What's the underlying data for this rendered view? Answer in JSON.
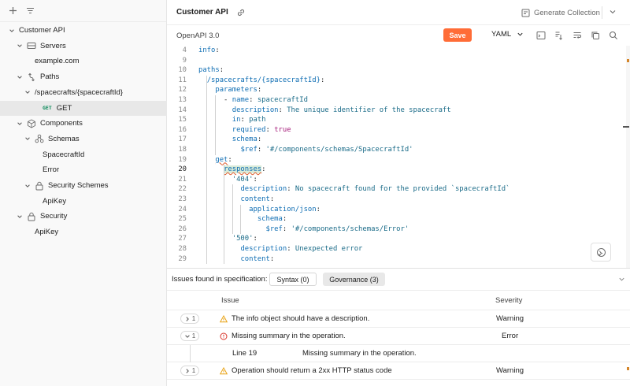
{
  "sidebar": {
    "tree": [
      {
        "label": "Customer API",
        "icon": "none",
        "chevron": "down",
        "level": 0
      },
      {
        "label": "Servers",
        "icon": "server-icon",
        "chevron": "down",
        "level": 1
      },
      {
        "label": "example.com",
        "icon": "none",
        "chevron": "none",
        "level": 2
      },
      {
        "label": "Paths",
        "icon": "paths-icon",
        "chevron": "down",
        "level": 1
      },
      {
        "label": "/spacecrafts/{spacecraftId}",
        "icon": "none",
        "chevron": "down",
        "level": 2
      },
      {
        "label": "GET",
        "method": "GET",
        "icon": "none",
        "chevron": "none",
        "level": 3,
        "selected": true
      },
      {
        "label": "Components",
        "icon": "cube-icon",
        "chevron": "down",
        "level": 1
      },
      {
        "label": "Schemas",
        "icon": "schema-icon",
        "chevron": "down",
        "level": 2
      },
      {
        "label": "SpacecraftId",
        "icon": "none",
        "chevron": "none",
        "level": 3
      },
      {
        "label": "Error",
        "icon": "none",
        "chevron": "none",
        "level": 3
      },
      {
        "label": "Security Schemes",
        "icon": "lock-icon",
        "chevron": "down",
        "level": 2
      },
      {
        "label": "ApiKey",
        "icon": "none",
        "chevron": "none",
        "level": 3
      },
      {
        "label": "Security",
        "icon": "lock-icon",
        "chevron": "down",
        "level": 1
      },
      {
        "label": "ApiKey",
        "icon": "none",
        "chevron": "none",
        "level": 2
      }
    ]
  },
  "header": {
    "title": "Customer API",
    "generate_label": "Generate Collection"
  },
  "toolbar": {
    "spec_version": "OpenAPI 3.0",
    "save_label": "Save",
    "format": "YAML"
  },
  "editor": {
    "lines": [
      {
        "n": "4",
        "tokens": [
          [
            "k",
            "info"
          ],
          [
            "p",
            ":"
          ]
        ]
      },
      {
        "n": "9",
        "tokens": []
      },
      {
        "n": "10",
        "tokens": [
          [
            "k",
            "paths"
          ],
          [
            "p",
            ":"
          ]
        ]
      },
      {
        "n": "11",
        "tokens": [
          [
            "p",
            "  "
          ],
          [
            "k",
            "/spacecrafts/{spacecraftId}"
          ],
          [
            "p",
            ":"
          ]
        ]
      },
      {
        "n": "12",
        "tokens": [
          [
            "p",
            "    "
          ],
          [
            "k",
            "parameters"
          ],
          [
            "p",
            ":"
          ]
        ]
      },
      {
        "n": "13",
        "tokens": [
          [
            "p",
            "      - "
          ],
          [
            "k",
            "name"
          ],
          [
            "p",
            ": "
          ],
          [
            "s",
            "spacecraftId"
          ]
        ]
      },
      {
        "n": "14",
        "tokens": [
          [
            "p",
            "        "
          ],
          [
            "k",
            "description"
          ],
          [
            "p",
            ": "
          ],
          [
            "s",
            "The unique identifier of the spacecraft"
          ]
        ]
      },
      {
        "n": "15",
        "tokens": [
          [
            "p",
            "        "
          ],
          [
            "k",
            "in"
          ],
          [
            "p",
            ": "
          ],
          [
            "s",
            "path"
          ]
        ]
      },
      {
        "n": "16",
        "tokens": [
          [
            "p",
            "        "
          ],
          [
            "k",
            "required"
          ],
          [
            "p",
            ": "
          ],
          [
            "t",
            "true"
          ]
        ]
      },
      {
        "n": "17",
        "tokens": [
          [
            "p",
            "        "
          ],
          [
            "k",
            "schema"
          ],
          [
            "p",
            ":"
          ]
        ]
      },
      {
        "n": "18",
        "tokens": [
          [
            "p",
            "          "
          ],
          [
            "k",
            "$ref"
          ],
          [
            "p",
            ": "
          ],
          [
            "s",
            "'#/components/schemas/SpacecraftId'"
          ]
        ]
      },
      {
        "n": "19",
        "tokens": [
          [
            "p",
            "    "
          ],
          [
            "k",
            "get"
          ],
          [
            "p",
            ":"
          ]
        ],
        "squiggle": 1
      },
      {
        "n": "20",
        "tokens": [
          [
            "p",
            "      "
          ],
          [
            "k",
            "responses"
          ],
          [
            "p",
            ":"
          ]
        ],
        "highlight": 1,
        "active": true
      },
      {
        "n": "21",
        "tokens": [
          [
            "p",
            "        "
          ],
          [
            "s",
            "'404'"
          ],
          [
            "p",
            ":"
          ]
        ]
      },
      {
        "n": "22",
        "tokens": [
          [
            "p",
            "          "
          ],
          [
            "k",
            "description"
          ],
          [
            "p",
            ": "
          ],
          [
            "s",
            "No spacecraft found for the provided `spacecraftId`"
          ]
        ]
      },
      {
        "n": "23",
        "tokens": [
          [
            "p",
            "          "
          ],
          [
            "k",
            "content"
          ],
          [
            "p",
            ":"
          ]
        ]
      },
      {
        "n": "24",
        "tokens": [
          [
            "p",
            "            "
          ],
          [
            "k",
            "application/json"
          ],
          [
            "p",
            ":"
          ]
        ]
      },
      {
        "n": "25",
        "tokens": [
          [
            "p",
            "              "
          ],
          [
            "k",
            "schema"
          ],
          [
            "p",
            ":"
          ]
        ]
      },
      {
        "n": "26",
        "tokens": [
          [
            "p",
            "                "
          ],
          [
            "k",
            "$ref"
          ],
          [
            "p",
            ": "
          ],
          [
            "s",
            "'#/components/schemas/Error'"
          ]
        ]
      },
      {
        "n": "27",
        "tokens": [
          [
            "p",
            "        "
          ],
          [
            "s",
            "'500'"
          ],
          [
            "p",
            ":"
          ]
        ]
      },
      {
        "n": "28",
        "tokens": [
          [
            "p",
            "          "
          ],
          [
            "k",
            "description"
          ],
          [
            "p",
            ": "
          ],
          [
            "s",
            "Unexpected error"
          ]
        ]
      },
      {
        "n": "29",
        "tokens": [
          [
            "p",
            "          "
          ],
          [
            "k",
            "content"
          ],
          [
            "p",
            ":"
          ]
        ]
      }
    ]
  },
  "issues": {
    "label": "Issues found in specification:",
    "tabs": {
      "syntax": "Syntax (0)",
      "governance": "Governance (3)"
    },
    "columns": {
      "issue": "Issue",
      "severity": "Severity"
    },
    "rows": [
      {
        "count": "1",
        "expanded": false,
        "type": "warning",
        "text": "The info object should have a description.",
        "severity": "Warning"
      },
      {
        "count": "1",
        "expanded": true,
        "type": "error",
        "text": "Missing summary in the operation.",
        "severity": "Error"
      },
      {
        "count": "1",
        "expanded": false,
        "type": "warning",
        "text": "Operation should return a 2xx HTTP status code",
        "severity": "Warning"
      }
    ],
    "detail": {
      "line": "Line 19",
      "message": "Missing summary in the operation."
    }
  },
  "colors": {
    "accent": "#ff6c37",
    "warning": "#e8a317",
    "error": "#d9362b",
    "method_get": "#0b8a5a"
  }
}
